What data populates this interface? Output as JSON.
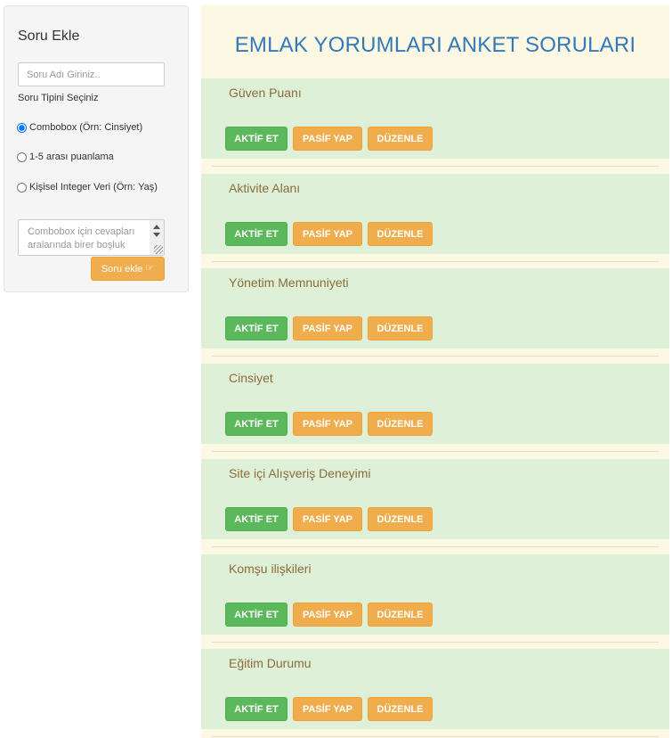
{
  "sidebar": {
    "title": "Soru Ekle",
    "name_placeholder": "Soru Adı Giriniz..",
    "type_label": "Soru Tipini Seçiniz",
    "options": [
      {
        "label": "Combobox (Örn: Cinsiyet)",
        "checked": true
      },
      {
        "label": "1-5 arası puanlama",
        "checked": false
      },
      {
        "label": "Kişisel Integer Veri (Örn: Yaş)",
        "checked": false
      }
    ],
    "answers_placeholder": "Combobox için cevapları aralarında birer boşluk",
    "add_button": "Soru ekle",
    "add_icon": "hand-point-right-icon"
  },
  "main": {
    "title": "EMLAK YORUMLARI ANKET SORULARI",
    "buttons": {
      "activate": "AKTİF ET",
      "deactivate": "PASİF YAP",
      "edit": "DÜZENLE"
    },
    "questions": [
      {
        "title": "Güven Puanı"
      },
      {
        "title": "Aktivite Alanı"
      },
      {
        "title": "Yönetim Memnuniyeti"
      },
      {
        "title": "Cinsiyet"
      },
      {
        "title": "Site içi Alışveriş Deneyimi"
      },
      {
        "title": "Komşu ilişkileri"
      },
      {
        "title": "Eğitim Durumu"
      }
    ]
  },
  "colors": {
    "success": "#5cb85c",
    "warning": "#f0ad4e",
    "card_bg": "#dff0d8",
    "page_bg": "#fcf8e3",
    "title": "#337ab7"
  }
}
